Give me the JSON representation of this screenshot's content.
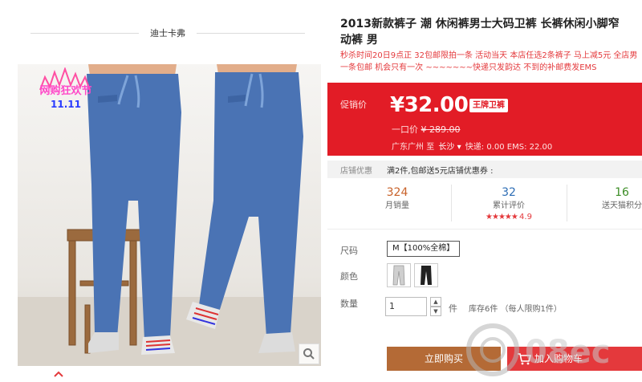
{
  "store": {
    "name": "迪士卡弗"
  },
  "badge": {
    "line1": "网购狂欢节",
    "line2": "11.11"
  },
  "product": {
    "title_line1": "2013新款裤子 潮 休闲裤男士大码卫裤 长裤休闲小脚窄",
    "title_line2": "动裤 男",
    "desc_line1": "秒杀时间20日9点正 32包邮限拍一条 活动当天 本店任选2条裤子 马上减5元 全店男",
    "desc_line2": "一条包邮 机会只有一次 ~~~~~~~快递只发韵达 不到的补邮费发EMS"
  },
  "price": {
    "label": "促销价",
    "value": "¥32.00",
    "tag": "王牌卫裤",
    "orig_label": "一口价",
    "orig_value": "¥ 289.00",
    "ship_from": "广东广州",
    "ship_to_word": "至",
    "ship_city": "长沙",
    "ship_fee": "快递: 0.00 EMS: 22.00"
  },
  "shop_promo": {
    "label": "店铺优惠",
    "text": "满2件,包邮送5元店铺优惠券 :"
  },
  "stats": {
    "sales_num": "324",
    "sales_cap": "月销量",
    "reviews_num": "32",
    "reviews_cap": "累计评价",
    "rating": "4.9",
    "rating_stars": 5,
    "points_num": "16",
    "points_cap": "送天猫积分"
  },
  "options": {
    "size_label": "尺码",
    "size_value": "M【100%全棉】",
    "color_label": "颜色",
    "qty_label": "数量",
    "qty_value": "1",
    "qty_unit": "件",
    "stock": "库存6件 （每人限购1件）"
  },
  "actions": {
    "buy": "立即购买",
    "cart": "加入购物车"
  },
  "watermark": {
    "text": "08ec"
  },
  "colors": {
    "accent": "#e21c26",
    "buy": "#b46a36",
    "stat_orange": "#c8622a",
    "stat_blue": "#2d6db5",
    "stat_green": "#3c8d26"
  },
  "icons": [
    "zoom-icon",
    "chevron-up-icon",
    "cart-icon",
    "star-icon",
    "spinner-up-icon",
    "spinner-down-icon"
  ]
}
